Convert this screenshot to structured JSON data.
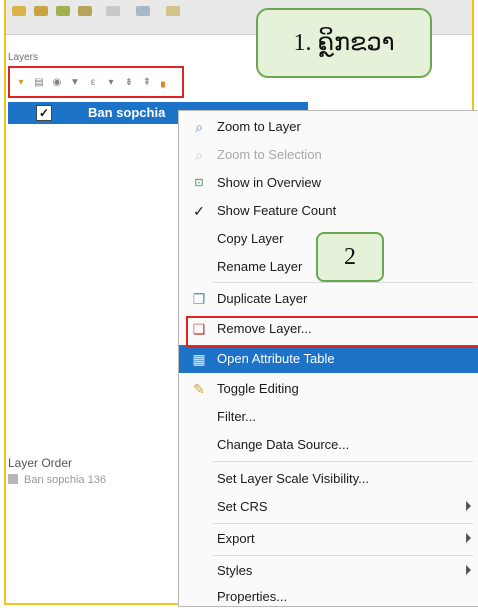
{
  "panel": {
    "title": "Layers"
  },
  "layer": {
    "name": "Ban sopchia",
    "checked": "✓"
  },
  "layer_order": {
    "title": "Layer Order",
    "item": "Ban sopchia 136"
  },
  "callouts": {
    "step1": "1. ຄຼິກຂວາ",
    "step2": "2"
  },
  "context_menu": {
    "items": [
      {
        "label": "Zoom to Layer",
        "icon": "zoom-layer-icon"
      },
      {
        "label": "Zoom to Selection",
        "icon": "zoom-selection-icon",
        "disabled": true
      },
      {
        "label": "Show in Overview",
        "icon": "overview-icon"
      },
      {
        "label": "Show Feature Count",
        "icon": "check-icon"
      },
      {
        "label": "Copy Layer"
      },
      {
        "label": "Rename Layer"
      },
      {
        "label": "Duplicate Layer",
        "icon": "duplicate-icon"
      },
      {
        "label": "Remove Layer...",
        "icon": "remove-layer-icon"
      },
      {
        "label": "Open Attribute Table",
        "icon": "table-icon",
        "selected": true
      },
      {
        "label": "Toggle Editing",
        "icon": "pencil-icon"
      },
      {
        "label": "Filter..."
      },
      {
        "label": "Change Data Source..."
      },
      {
        "label": "Set Layer Scale Visibility..."
      },
      {
        "label": "Set CRS",
        "submenu": true
      },
      {
        "label": "Export",
        "submenu": true
      },
      {
        "label": "Styles",
        "submenu": true
      },
      {
        "label": "Properties..."
      }
    ]
  },
  "colors": {
    "selection": "#1c73c8",
    "highlight_box": "#e02424",
    "callout_fill": "#e5f2d9",
    "callout_border": "#6aa84f",
    "frame": "#f0c419"
  }
}
